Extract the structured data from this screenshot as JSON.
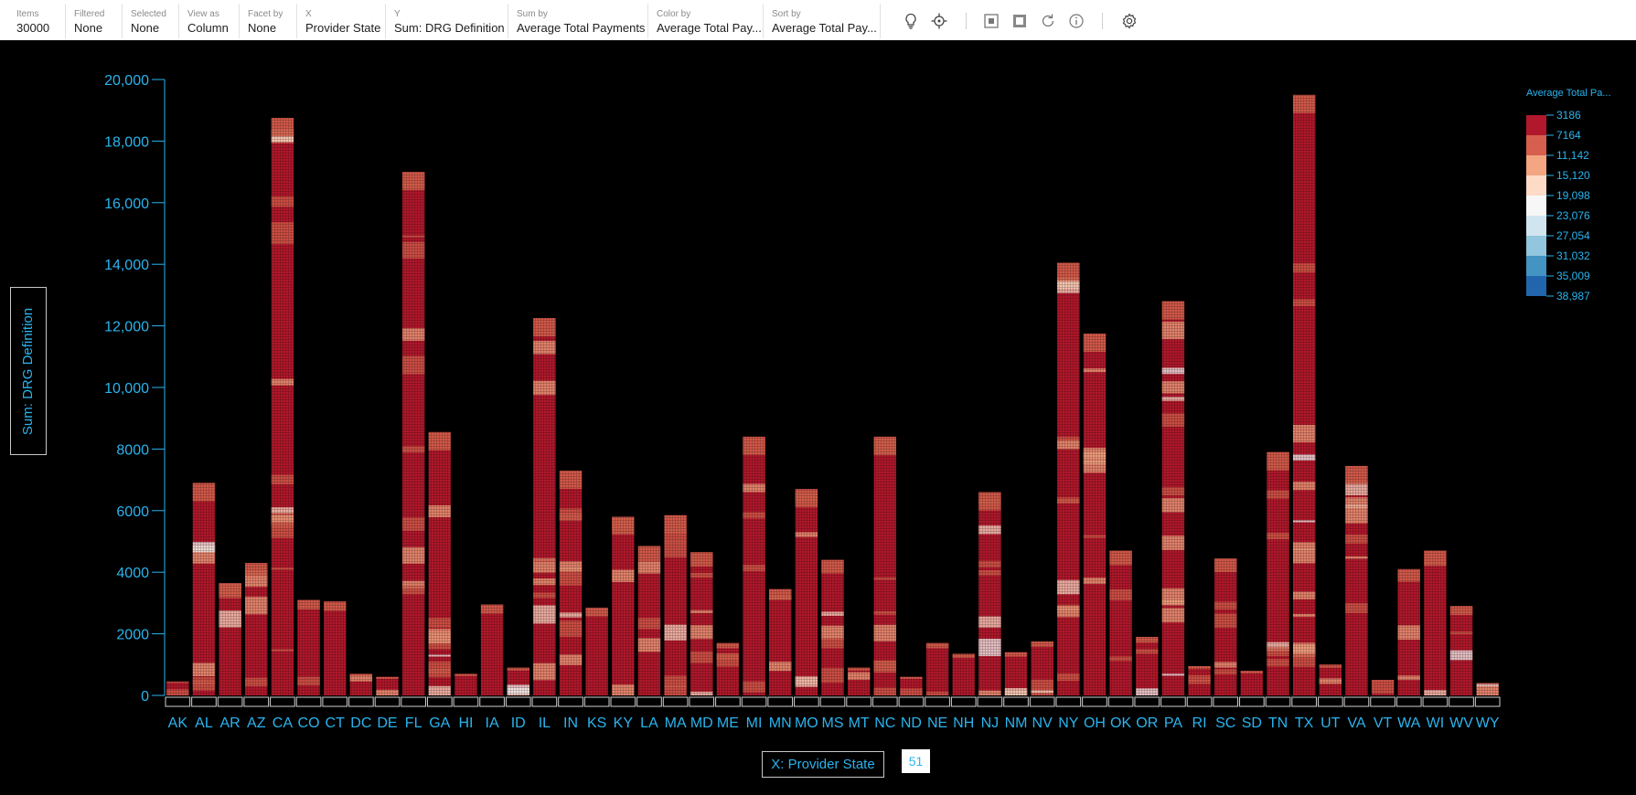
{
  "toolbar": {
    "fields": [
      {
        "caption": "Items",
        "value": "30000"
      },
      {
        "caption": "Filtered",
        "value": "None"
      },
      {
        "caption": "Selected",
        "value": "None"
      },
      {
        "caption": "View as",
        "value": "Column"
      },
      {
        "caption": "Facet by",
        "value": "None"
      },
      {
        "caption": "X",
        "value": "Provider State"
      },
      {
        "caption": "Y",
        "value": "Sum: DRG Definition"
      },
      {
        "caption": "Sum by",
        "value": "Average Total Payments"
      },
      {
        "caption": "Color by",
        "value": "Average Total Pay..."
      },
      {
        "caption": "Sort by",
        "value": "Average Total Pay..."
      }
    ],
    "icons": [
      "lightbulb-icon",
      "crosshair-icon",
      "select-square-icon",
      "select-filled-icon",
      "refresh-icon",
      "info-icon",
      "gear-icon"
    ]
  },
  "x_axis_button": "X: Provider State",
  "y_axis_button": "Sum: DRG Definition",
  "count_badge": "51",
  "legend": {
    "title": "Average Total Pa...",
    "labels": [
      "3186",
      "7164",
      "11,142",
      "15,120",
      "19,098",
      "23,076",
      "27,054",
      "31,032",
      "35,009",
      "38,987"
    ],
    "colors": [
      "#b2182b",
      "#d6604d",
      "#f4a582",
      "#fddbc7",
      "#f7f7f7",
      "#d1e5f0",
      "#92c5de",
      "#4393c3",
      "#2166ac"
    ]
  },
  "chart_data": {
    "type": "bar",
    "categories": [
      "AK",
      "AL",
      "AR",
      "AZ",
      "CA",
      "CO",
      "CT",
      "DC",
      "DE",
      "FL",
      "GA",
      "HI",
      "IA",
      "ID",
      "IL",
      "IN",
      "KS",
      "KY",
      "LA",
      "MA",
      "MD",
      "ME",
      "MI",
      "MN",
      "MO",
      "MS",
      "MT",
      "NC",
      "ND",
      "NE",
      "NH",
      "NJ",
      "NM",
      "NV",
      "NY",
      "OH",
      "OK",
      "OR",
      "PA",
      "RI",
      "SC",
      "SD",
      "TN",
      "TX",
      "UT",
      "VA",
      "VT",
      "WA",
      "WI",
      "WV",
      "WY"
    ],
    "values": [
      450,
      6900,
      3650,
      4300,
      18750,
      3100,
      3050,
      700,
      600,
      17000,
      8550,
      700,
      2950,
      900,
      12250,
      7300,
      2850,
      5800,
      4850,
      5850,
      4650,
      1700,
      8400,
      3450,
      6700,
      4400,
      900,
      8400,
      600,
      1700,
      1350,
      6600,
      1400,
      1750,
      14050,
      11750,
      4700,
      1900,
      12800,
      950,
      4450,
      800,
      7900,
      19500,
      1000,
      7450,
      500,
      4100,
      4700,
      2900,
      400
    ],
    "ylabel": "Sum: DRG Definition",
    "xlabel": "X: Provider State",
    "ylim": [
      0,
      20000
    ],
    "yticks": [
      {
        "value": 0,
        "label": "0"
      },
      {
        "value": 2000,
        "label": "2000"
      },
      {
        "value": 4000,
        "label": "4000"
      },
      {
        "value": 6000,
        "label": "6000"
      },
      {
        "value": 8000,
        "label": "8000"
      },
      {
        "value": 10000,
        "label": "10,000"
      },
      {
        "value": 12000,
        "label": "12,000"
      },
      {
        "value": 14000,
        "label": "14,000"
      },
      {
        "value": 16000,
        "label": "16,000"
      },
      {
        "value": 18000,
        "label": "18,000"
      },
      {
        "value": 20000,
        "label": "20,000"
      }
    ],
    "grid": false,
    "legend_position": "top-right",
    "colors": {
      "axis": "#2ab4ee",
      "text": "#2ab4ee",
      "background": "#000000"
    }
  }
}
